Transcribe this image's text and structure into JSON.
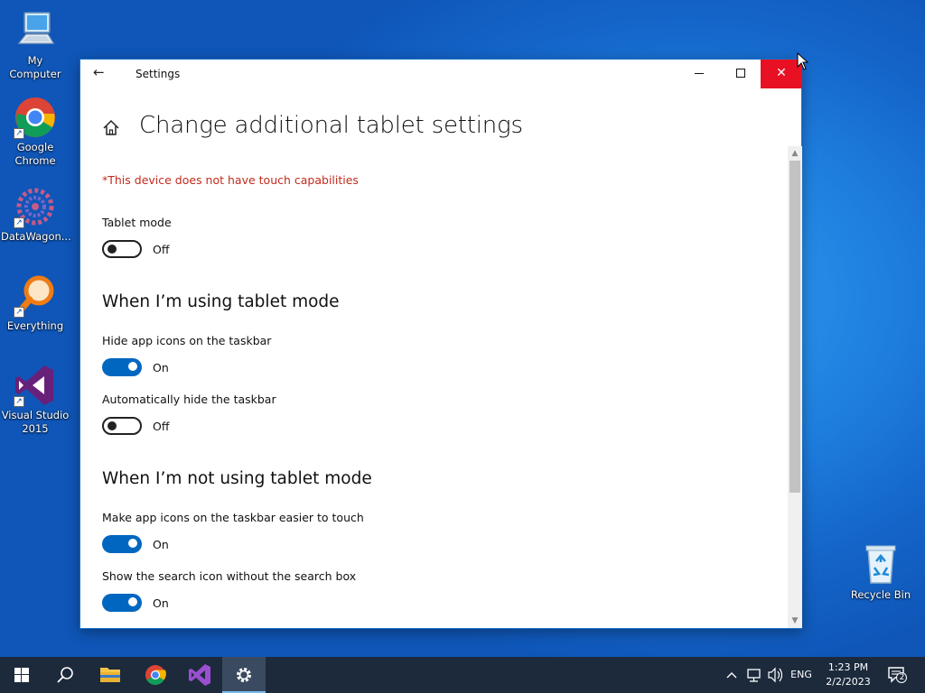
{
  "desktop": {
    "icons": [
      {
        "label": "My Computer"
      },
      {
        "label": "Google Chrome"
      },
      {
        "label": "DataWagon..."
      },
      {
        "label": "Everything"
      },
      {
        "label": "Visual Studio 2015"
      },
      {
        "label": "Recycle Bin"
      }
    ]
  },
  "window": {
    "title": "Settings",
    "page_title": "Change additional tablet settings",
    "warning": "*This device does not have touch capabilities",
    "tablet_mode": {
      "label": "Tablet mode",
      "state": "Off"
    },
    "section_using": {
      "title": "When I’m using tablet mode",
      "hide_icons": {
        "label": "Hide app icons on the taskbar",
        "state": "On"
      },
      "auto_hide": {
        "label": "Automatically hide the taskbar",
        "state": "Off"
      }
    },
    "section_not_using": {
      "title": "When I’m not using tablet mode",
      "easier_touch": {
        "label": "Make app icons on the taskbar easier to touch",
        "state": "On"
      },
      "search_icon": {
        "label": "Show the search icon without the search box",
        "state": "On"
      }
    }
  },
  "taskbar": {
    "language": "ENG",
    "time": "1:23 PM",
    "date": "2/2/2023",
    "notification_count": "2"
  },
  "colors": {
    "accent": "#0067c0",
    "close_red": "#e81123",
    "warning": "#c42b1c"
  }
}
